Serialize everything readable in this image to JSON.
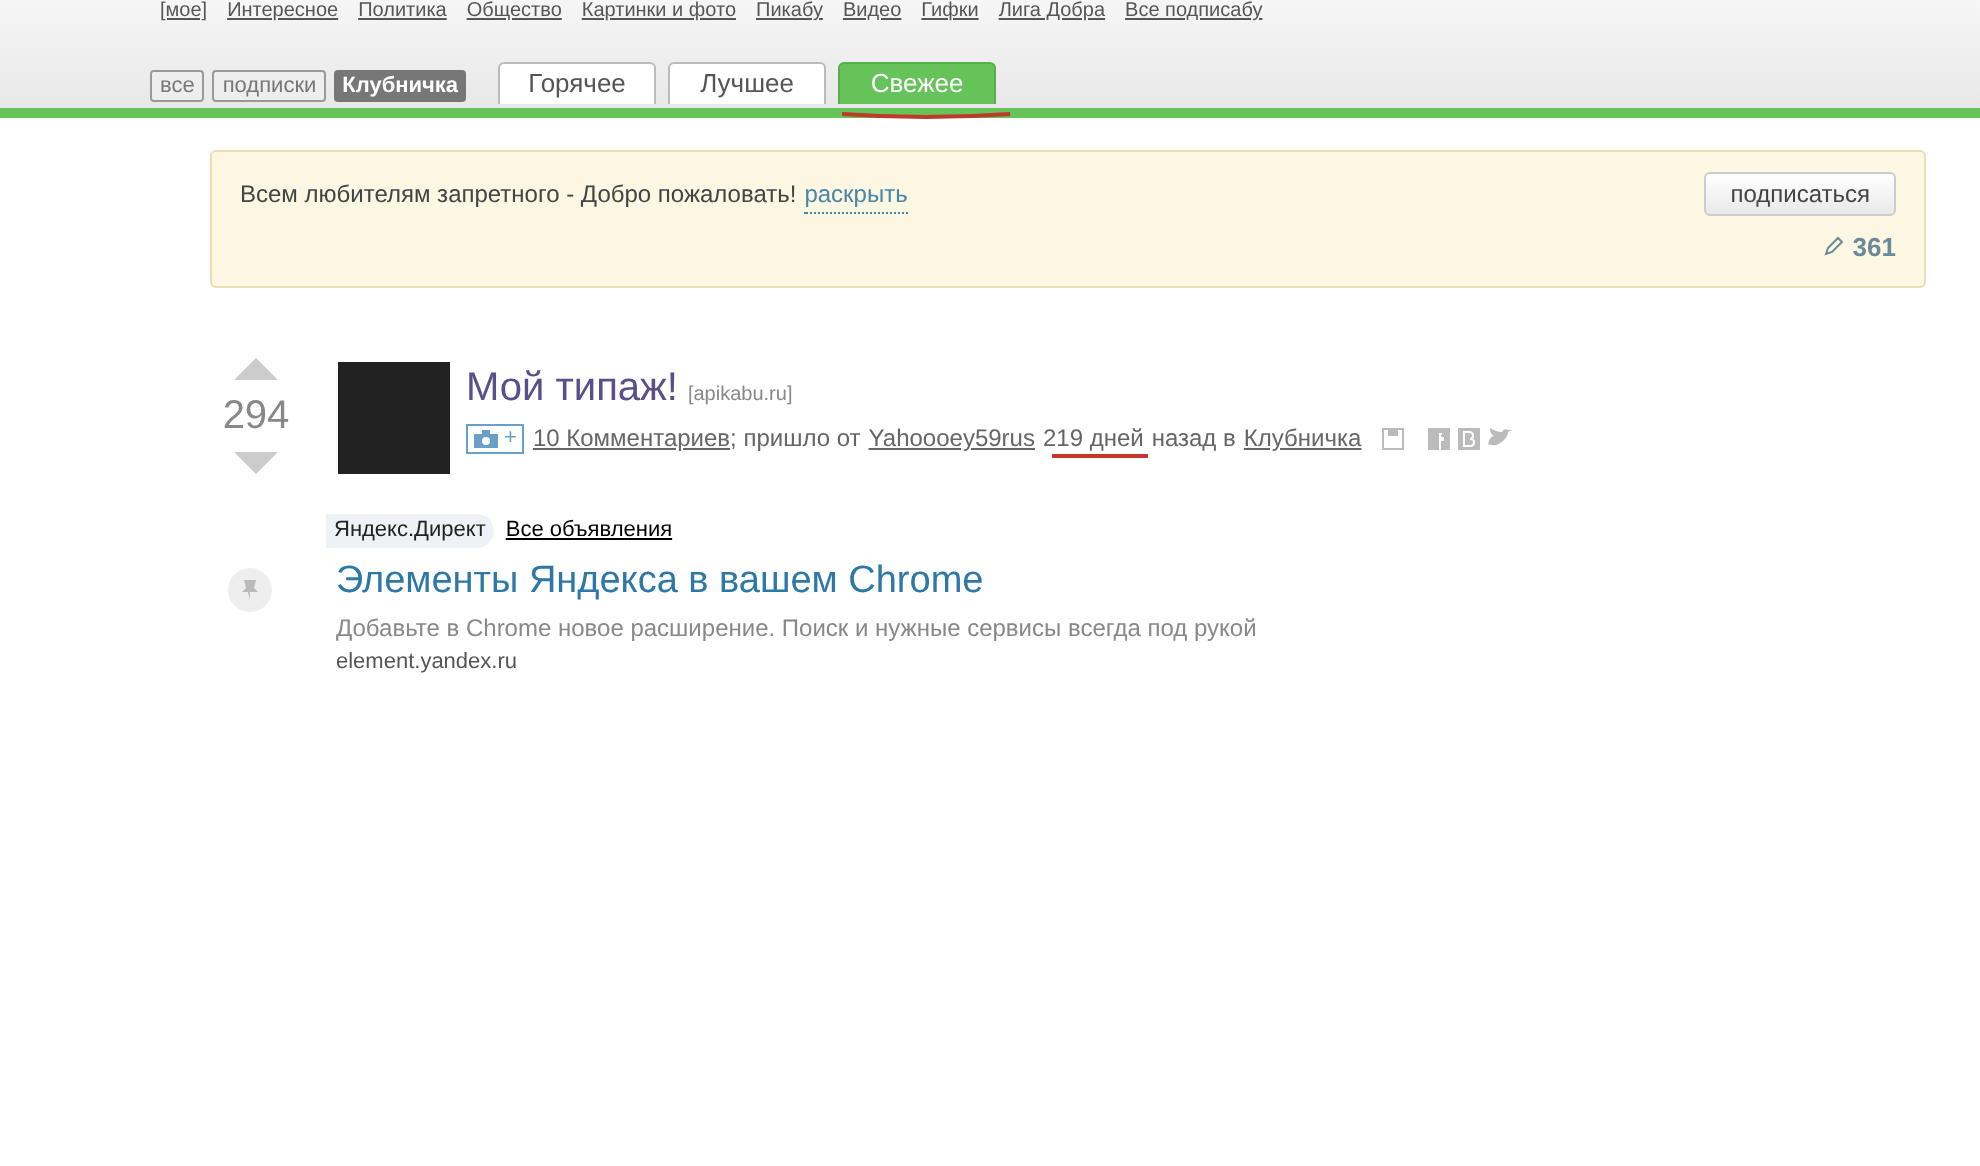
{
  "nav_links": [
    "[мое]",
    "Интересное",
    "Политика",
    "Общество",
    "Картинки и фото",
    "Пикабу",
    "Видео",
    "Гифки",
    "Лига Добра",
    "Все подписабу"
  ],
  "filters": [
    {
      "label": "все",
      "selected": false
    },
    {
      "label": "подписки",
      "selected": false
    },
    {
      "label": "Клубничка",
      "selected": true
    }
  ],
  "tabs": [
    {
      "label": "Горячее",
      "selected": false,
      "marked": false
    },
    {
      "label": "Лучшее",
      "selected": false,
      "marked": false
    },
    {
      "label": "Свежее",
      "selected": true,
      "marked": true
    }
  ],
  "community": {
    "text": "Всем любителям запретного - Добро пожаловать!",
    "expand_link": "раскрыть",
    "subscribe_button": "подписаться",
    "count": "361"
  },
  "post": {
    "rating": "294",
    "title": "Мой типаж!",
    "source": "[apikabu.ru]",
    "photo_tag": "+",
    "comments_link": "10 Комментариев",
    "came_from": "; пришло от",
    "author": "Yahoooey59rus",
    "age": "219 дней",
    "age_marked": true,
    "age_suffix": "назад в",
    "category": "Клубничка"
  },
  "ad": {
    "label": "Яндекс.Директ",
    "all_ads_link": "Все объявления",
    "title": "Элементы Яндекса в вашем Chrome",
    "description": "Добавьте в Chrome новое расширение. Поиск и нужные сервисы всегда под рукой",
    "url": "element.yandex.ru"
  }
}
